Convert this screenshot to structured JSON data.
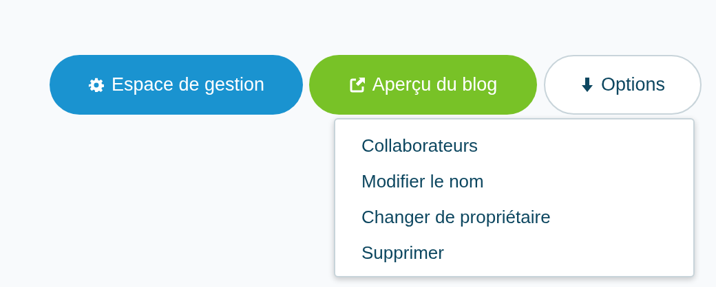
{
  "buttons": [
    {
      "kind": "manage",
      "label": "Espace de gestion"
    },
    {
      "kind": "preview",
      "label": "Aperçu du blog"
    },
    {
      "kind": "options",
      "label": "Options"
    }
  ],
  "options_menu": {
    "expanded": true,
    "items": [
      {
        "label": "Collaborateurs"
      },
      {
        "label": "Modifier le nom"
      },
      {
        "label": "Changer de propriétaire"
      },
      {
        "label": "Supprimer"
      }
    ]
  }
}
